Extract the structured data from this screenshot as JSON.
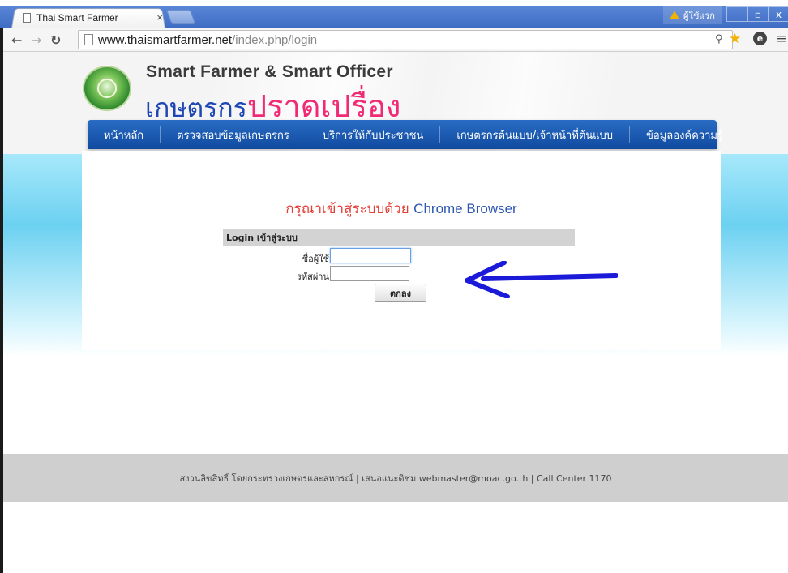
{
  "browser": {
    "tab_title": "Thai Smart Farmer",
    "tab_close": "×",
    "user_badge": "ผู้ใช้แรก",
    "window_buttons": {
      "minimize": "–",
      "maximize": "▫",
      "close": "x"
    },
    "url_host": "www.thaismartfarmer.net",
    "url_path": "/index.php/login",
    "icons": [
      "back-icon",
      "forward-icon",
      "reload-icon",
      "page-icon",
      "zoom-icon",
      "star-icon",
      "extension-icon",
      "menu-icon"
    ]
  },
  "site": {
    "title_en": "Smart Farmer & Smart Officer",
    "title_th_part1": "เกษตรกร",
    "title_th_part2": "ปราดเปรื่อง",
    "menu": [
      "หน้าหลัก",
      "ตรวจสอบข้อมูลเกษตรกร",
      "บริการให้กับประชาชน",
      "เกษตรกรต้นแบบ/เจ้าหน้าที่ต้นแบบ",
      "ข้อมูลองค์ความรู้"
    ]
  },
  "login": {
    "notice_th": "กรุณาเข้าสู่ระบบด้วย",
    "notice_en": "Chrome Browser",
    "header": "Login เข้าสู่ระบบ",
    "username_label": "ชื่อผู้ใช้",
    "password_label": "รหัสผ่าน",
    "username_value": "",
    "password_value": "",
    "submit_label": "ตกลง"
  },
  "footer": {
    "text": "สงวนลิขสิทธิ์ โดยกระทรวงเกษตรและสหกรณ์ | เสนอแนะติชม webmaster@moac.go.th | Call Center 1170"
  },
  "colors": {
    "menu_bar": "#1a5bb0",
    "title_th_blue": "#1e46b4",
    "title_th_pink": "#f02a74",
    "notice_red": "#e43d35",
    "notice_blue": "#2f57b1",
    "arrow": "#1a1ad8"
  }
}
